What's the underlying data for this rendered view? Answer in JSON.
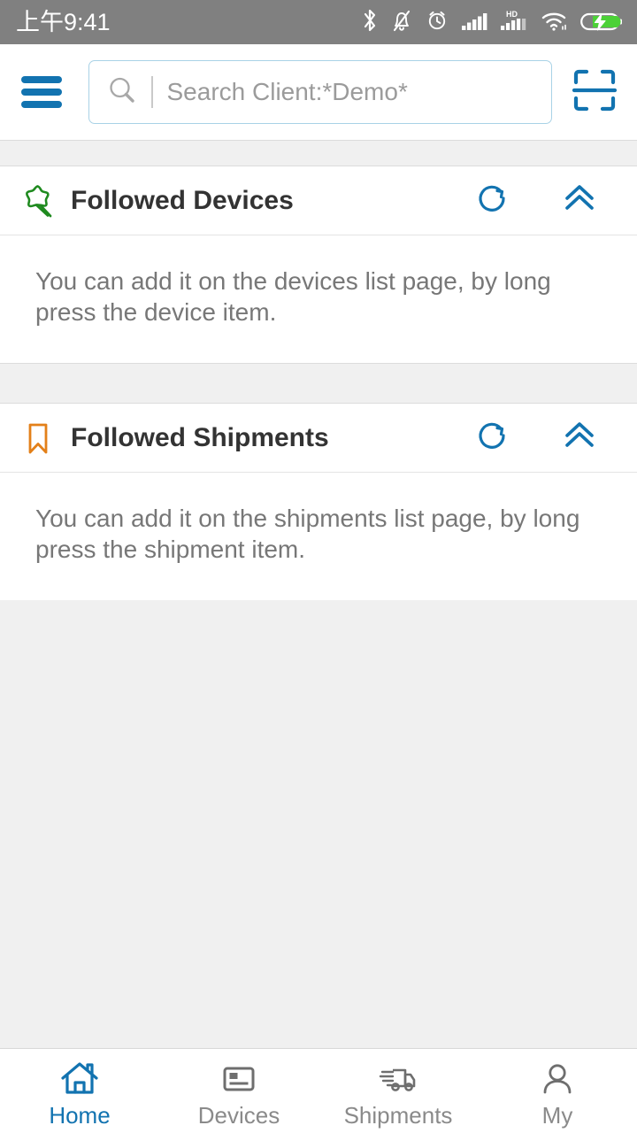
{
  "status_bar": {
    "time": "上午9:41",
    "background": "#808080",
    "text_color": "#ffffff",
    "icons": [
      "bluetooth-icon",
      "notifications-silent-icon",
      "alarm-clock-icon",
      "cellular-signal-icon",
      "hd-cellular-signal-icon",
      "wifi-icon",
      "battery-charging-icon"
    ],
    "battery_color": "#4cd137"
  },
  "top_bar": {
    "menu_icon": "hamburger-menu-icon",
    "menu_color": "#1273b0",
    "search": {
      "icon": "search-icon",
      "placeholder": "Search Client:*Demo*",
      "value": "",
      "border_color": "#a9d2e6"
    },
    "scan_icon": "scan-qr-icon",
    "scan_color": "#1273b0"
  },
  "sections": [
    {
      "id": "followed-devices",
      "title": "Followed Devices",
      "icon": "star-pin-icon",
      "icon_color": "#1f8a1f",
      "refresh_icon": "refresh-icon",
      "collapse_icon": "double-chevron-up-icon",
      "action_color": "#1273b0",
      "empty_text": "You can add it on the devices list page, by long press the device item."
    },
    {
      "id": "followed-shipments",
      "title": "Followed Shipments",
      "icon": "bookmark-icon",
      "icon_color": "#e38019",
      "refresh_icon": "refresh-icon",
      "collapse_icon": "double-chevron-up-icon",
      "action_color": "#1273b0",
      "empty_text": "You can add it on the shipments list page, by long press the shipment item."
    }
  ],
  "bottom_nav": {
    "active_color": "#1273b0",
    "inactive_color": "#8a8a8a",
    "items": [
      {
        "label": "Home",
        "icon": "home-icon",
        "active": true
      },
      {
        "label": "Devices",
        "icon": "device-card-icon",
        "active": false
      },
      {
        "label": "Shipments",
        "icon": "delivery-truck-icon",
        "active": false
      },
      {
        "label": "My",
        "icon": "user-profile-icon",
        "active": false
      }
    ]
  }
}
